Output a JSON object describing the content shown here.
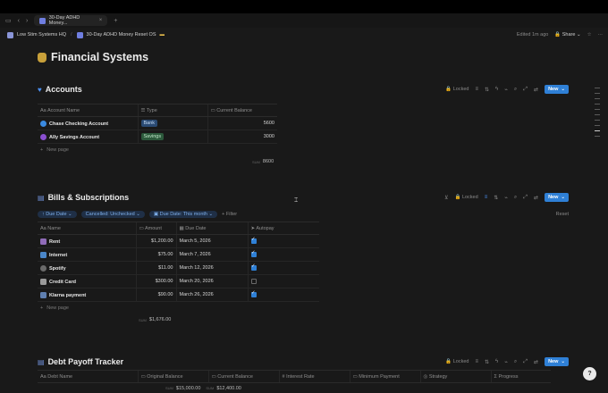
{
  "browser": {
    "tab_title": "30-Day ADHD Money...",
    "new_tab": "+"
  },
  "breadcrumb": {
    "items": [
      "Low Stim Systems HQ",
      "30-Day ADHD Money Reset OS"
    ],
    "edited": "Edited 1m ago",
    "share": "Share"
  },
  "page": {
    "title": "Financial Systems"
  },
  "toolbar": {
    "locked": "Locked",
    "new": "New"
  },
  "accounts": {
    "title": "Accounts",
    "columns": [
      "Account Name",
      "Type",
      "Current Balance"
    ],
    "rows": [
      {
        "name": "Chase Checking Account",
        "type": "Bank",
        "balance": "5600"
      },
      {
        "name": "Ally Savings Account",
        "type": "Savings",
        "balance": "3000"
      }
    ],
    "new_page": "New page",
    "sum_label": "SUM",
    "sum_value": "8600"
  },
  "bills": {
    "title": "Bills & Subscriptions",
    "filters": [
      "Due Date",
      "Cancelled: Unchecked",
      "Due Date: This month"
    ],
    "add_filter": "+ Filter",
    "reset": "Reset",
    "columns": [
      "Name",
      "Amount",
      "Due Date",
      "Autopay"
    ],
    "rows": [
      {
        "name": "Rent",
        "amount": "$1,200.00",
        "due": "March 5, 2026",
        "autopay": true
      },
      {
        "name": "Internet",
        "amount": "$75.00",
        "due": "March 7, 2026",
        "autopay": true
      },
      {
        "name": "Spotify",
        "amount": "$11.00",
        "due": "March 12, 2026",
        "autopay": true
      },
      {
        "name": "Credit Card",
        "amount": "$300.00",
        "due": "March 20, 2026",
        "autopay": false
      },
      {
        "name": "Klarna payment",
        "amount": "$90.00",
        "due": "March 26, 2026",
        "autopay": true
      }
    ],
    "new_page": "New page",
    "sum_label": "SUM",
    "sum_value": "$1,676.00"
  },
  "debt": {
    "title": "Debt Payoff Tracker",
    "columns": [
      "Debt Name",
      "Original Balance",
      "Current Balance",
      "Interest Rate",
      "Minimum Payment",
      "Strategy",
      "Progress"
    ],
    "sum_label": "SUM",
    "sum_original": "$15,000.00",
    "sum_current": "$12,400.00"
  },
  "colors": {
    "accent": "#2f80d6",
    "background": "#191919",
    "tag_bank": "#2a4a73",
    "tag_savings": "#2c5a3c"
  }
}
